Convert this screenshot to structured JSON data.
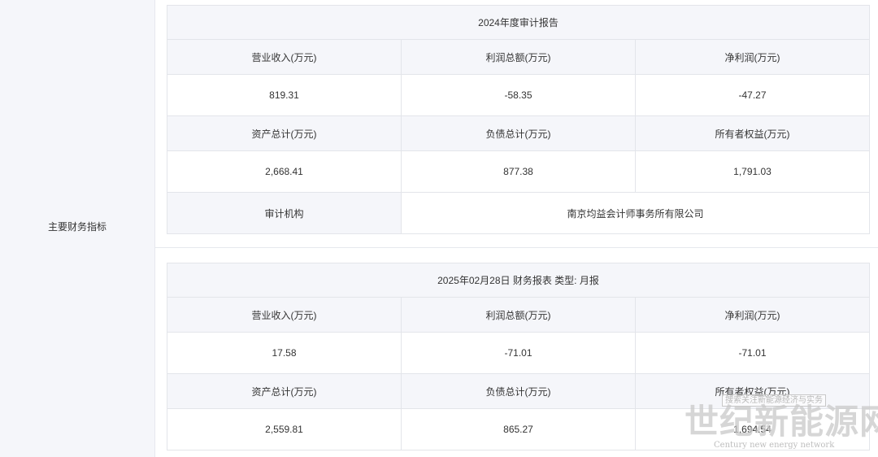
{
  "sidebar": {
    "label": "主要财务指标"
  },
  "annual_report": {
    "title": "2024年度审计报告",
    "row1_headers": [
      "营业收入(万元)",
      "利润总额(万元)",
      "净利润(万元)"
    ],
    "row1_values": [
      "819.31",
      "-58.35",
      "-47.27"
    ],
    "row2_headers": [
      "资产总计(万元)",
      "负债总计(万元)",
      "所有者权益(万元)"
    ],
    "row2_values": [
      "2,668.41",
      "877.38",
      "1,791.03"
    ],
    "audit_label": "审计机构",
    "audit_value": "南京均益会计师事务所有限公司"
  },
  "monthly_report": {
    "title": "2025年02月28日 财务报表 类型: 月报",
    "row1_headers": [
      "营业收入(万元)",
      "利润总额(万元)",
      "净利润(万元)"
    ],
    "row1_values": [
      "17.58",
      "-71.01",
      "-71.01"
    ],
    "row2_headers": [
      "资产总计(万元)",
      "负债总计(万元)",
      "所有者权益(万元)"
    ],
    "row2_values": [
      "2,559.81",
      "865.27",
      "1,694.54"
    ]
  },
  "watermark": {
    "small_text": "搜索关注新能源经济与实务",
    "big_text": "世纪新能源网",
    "english_text": "Century new energy network"
  }
}
